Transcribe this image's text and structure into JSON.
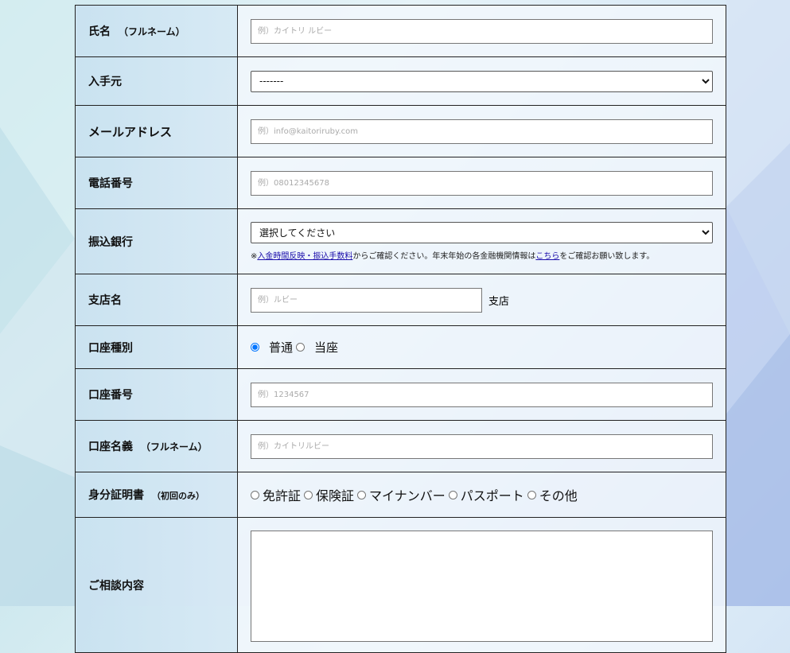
{
  "fields": {
    "name": {
      "label": "氏名",
      "sub": "（フルネーム）",
      "placeholder": "例）カイトリ ルビー"
    },
    "source": {
      "label": "入手元",
      "selected": "-------"
    },
    "email": {
      "label": "メールアドレス",
      "placeholder": "例）info@kaitoriruby.com"
    },
    "phone": {
      "label": "電話番号",
      "placeholder": "例）08012345678"
    },
    "bank": {
      "label": "振込銀行",
      "selected": "選択してください",
      "note_prefix": "※",
      "note_link1": "入金時間反映・振込手数料",
      "note_mid": "からご確認ください。年末年始の各金融機関情報は",
      "note_link2": "こちら",
      "note_suffix": "をご確認お願い致します。"
    },
    "branch": {
      "label": "支店名",
      "placeholder": "例）ルビー",
      "suffix": "支店"
    },
    "account_type": {
      "label": "口座種別",
      "options": [
        "普通",
        "当座"
      ],
      "selected": "普通"
    },
    "account_number": {
      "label": "口座番号",
      "placeholder": "例）1234567"
    },
    "account_name": {
      "label": "口座名義",
      "sub": "（フルネーム）",
      "placeholder": "例）カイトリルビー"
    },
    "id_doc": {
      "label": "身分証明書",
      "sub": "（初回のみ）",
      "options": [
        "免許証",
        "保険証",
        "マイナンバー",
        "パスポート",
        "その他"
      ]
    },
    "inquiry": {
      "label": "ご相談内容"
    }
  }
}
